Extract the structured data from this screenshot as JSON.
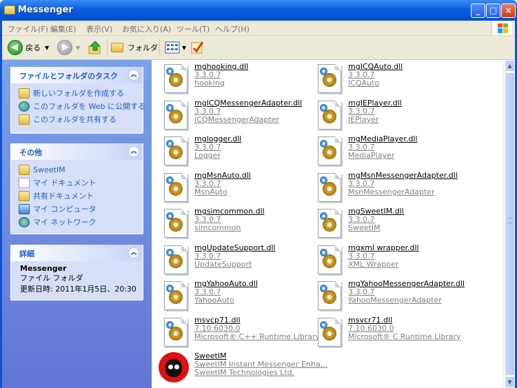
{
  "window": {
    "title": "Messenger"
  },
  "menu": [
    "ファイル(F)",
    "編集(E)",
    "表示(V)",
    "お気に入り(A)",
    "ツール(T)",
    "ヘルプ(H)"
  ],
  "toolbar": {
    "back": "戻る",
    "folders": "フォルダ"
  },
  "tasks_panel": {
    "title": "ファイルとフォルダのタスク",
    "items": [
      "新しいフォルダを作成する",
      "このフォルダを Web に公開する",
      "このフォルダを共有する"
    ]
  },
  "other_panel": {
    "title": "その他",
    "items": [
      "SweetIM",
      "マイ ドキュメント",
      "共有ドキュメント",
      "マイ コンピュータ",
      "マイ ネットワーク"
    ]
  },
  "details_panel": {
    "title": "詳細",
    "name": "Messenger",
    "type": "ファイル フォルダ",
    "modified": "更新日時: 2011年1月5日、20:30"
  },
  "files": [
    {
      "name": "mghooking.dll",
      "version": "3.3.0.7",
      "desc": "hooking",
      "icon": "dll-gear-icon"
    },
    {
      "name": "mgICQAuto.dll",
      "version": "3.3.0.7",
      "desc": "ICQAuto",
      "icon": "dll-gear-icon"
    },
    {
      "name": "mgICQMessengerAdapter.dll",
      "version": "3.3.0.7",
      "desc": "ICQMessengerAdapter",
      "icon": "dll-gear-icon"
    },
    {
      "name": "mgIEPlayer.dll",
      "version": "3.3.0.7",
      "desc": "IEPlayer",
      "icon": "dll-gear-icon"
    },
    {
      "name": "mglogger.dll",
      "version": "3.3.0.7",
      "desc": "Logger",
      "icon": "dll-gear-icon"
    },
    {
      "name": "mgMediaPlayer.dll",
      "version": "3.3.0.7",
      "desc": "MediaPlayer",
      "icon": "dll-gear-icon"
    },
    {
      "name": "mgMsnAuto.dll",
      "version": "3.3.0.7",
      "desc": "MsnAuto",
      "icon": "dll-gear-icon"
    },
    {
      "name": "mgMsnMessengerAdapter.dll",
      "version": "3.3.0.7",
      "desc": "MsnMessengerAdapter",
      "icon": "dll-gear-icon"
    },
    {
      "name": "mgsimcommon.dll",
      "version": "3.3.0.7",
      "desc": "simcommon",
      "icon": "dll-gear-icon"
    },
    {
      "name": "mgSweetIM.dll",
      "version": "3.3.0.7",
      "desc": "SweetIM",
      "icon": "dll-gear-icon"
    },
    {
      "name": "mgUpdateSupport.dll",
      "version": "3.3.0.7",
      "desc": "UpdateSupport",
      "icon": "dll-gear-icon"
    },
    {
      "name": "mgxml wrapper.dll",
      "version": "3.3.0.7",
      "desc": "XML Wrapper",
      "icon": "dll-gear-icon"
    },
    {
      "name": "mgYahooAuto.dll",
      "version": "3.3.0.7",
      "desc": "YahooAuto",
      "icon": "dll-gear-icon"
    },
    {
      "name": "mgYahooMessengerAdapter.dll",
      "version": "3.3.0.7",
      "desc": "YahooMessengerAdapter",
      "icon": "dll-gear-icon"
    },
    {
      "name": "msvcp71.dll",
      "version": "7.10.6030.0",
      "desc": "Microsoft® C++ Runtime Library",
      "icon": "dll-gear-icon"
    },
    {
      "name": "msvcr71.dll",
      "version": "7.10.6030.0",
      "desc": "Microsoft® C Runtime Library",
      "icon": "dll-gear-icon"
    },
    {
      "name": "SweetIM",
      "version": "SweetIM Instant Messenger Enha...",
      "desc": "SweetIM Technologies Ltd.",
      "icon": "sweetim-monkey-icon"
    }
  ]
}
